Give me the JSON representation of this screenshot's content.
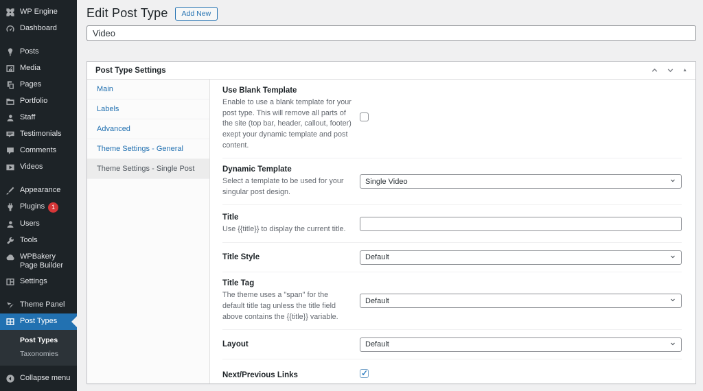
{
  "sidebar": {
    "items": [
      {
        "label": "WP Engine",
        "icon": "wpengine"
      },
      {
        "label": "Dashboard",
        "icon": "dashboard"
      },
      {
        "label": "Posts",
        "icon": "pin"
      },
      {
        "label": "Media",
        "icon": "media"
      },
      {
        "label": "Pages",
        "icon": "pages"
      },
      {
        "label": "Portfolio",
        "icon": "folder"
      },
      {
        "label": "Staff",
        "icon": "person"
      },
      {
        "label": "Testimonials",
        "icon": "testimonial"
      },
      {
        "label": "Comments",
        "icon": "comment"
      },
      {
        "label": "Videos",
        "icon": "video"
      },
      {
        "label": "Appearance",
        "icon": "brush"
      },
      {
        "label": "Plugins",
        "icon": "plug",
        "badge": "1"
      },
      {
        "label": "Users",
        "icon": "person"
      },
      {
        "label": "Tools",
        "icon": "wrench"
      },
      {
        "label": "WPBakery Page Builder",
        "icon": "cloud"
      },
      {
        "label": "Settings",
        "icon": "settings"
      },
      {
        "label": "Theme Panel",
        "icon": "theme-panel"
      },
      {
        "label": "Post Types",
        "icon": "grid"
      }
    ],
    "selected_item": "Post Types",
    "plugins_badge": "1",
    "submenu": {
      "items": [
        "Post Types",
        "Taxonomies"
      ],
      "current": "Post Types"
    },
    "collapse_label": "Collapse menu"
  },
  "header": {
    "title": "Edit Post Type",
    "add_new_label": "Add New"
  },
  "name_field": {
    "value": "Video"
  },
  "panel": {
    "title": "Post Type Settings",
    "tabs": [
      "Main",
      "Labels",
      "Advanced",
      "Theme Settings - General",
      "Theme Settings - Single Post"
    ],
    "selected_tab": "Theme Settings - Single Post",
    "rows": [
      {
        "label": "Use Blank Template",
        "description": "Enable to use a blank template for your post type. This will remove all parts of the site (top bar, header, callout, footer) exept your dynamic template and post content.",
        "control": "checkbox",
        "checked": false
      },
      {
        "label": "Dynamic Template",
        "description": "Select a template to be used for your singular post design.",
        "control": "select",
        "value": "Single Video"
      },
      {
        "label": "Title",
        "description": "Use {{title}} to display the current title.",
        "control": "text",
        "value": ""
      },
      {
        "label": "Title Style",
        "description": "",
        "control": "select",
        "value": "Default"
      },
      {
        "label": "Title Tag",
        "description": "The theme uses a \"span\" for the default title tag unless the title field above contains the {{title}} variable.",
        "control": "select",
        "value": "Default"
      },
      {
        "label": "Layout",
        "description": "",
        "control": "select",
        "value": "Default"
      },
      {
        "label": "Next/Previous Links",
        "description": "",
        "control": "checkbox",
        "checked": true
      }
    ]
  },
  "colors": {
    "sidebar_bg": "#1d2327",
    "submenu_bg": "#2c3338",
    "accent_blue": "#2271b1",
    "selected_menu_bg": "#2271b1",
    "badge_red": "#d63638",
    "page_bg": "#f0f0f1",
    "panel_border": "#c3c4c7",
    "description_gray": "#646970",
    "check_blue": "#3582c4"
  }
}
